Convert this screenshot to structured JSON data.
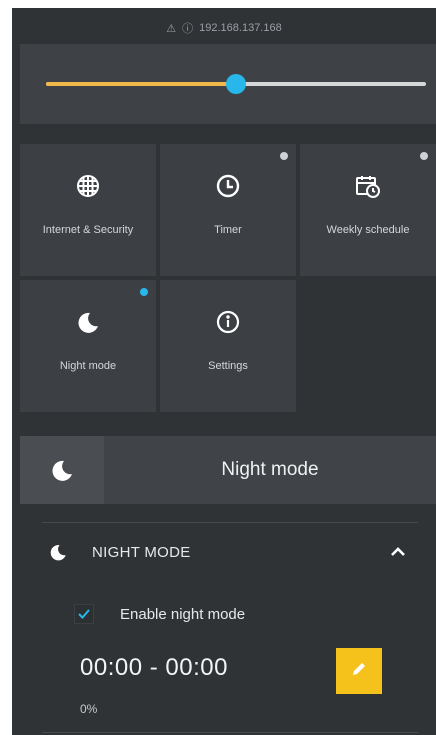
{
  "address_bar": {
    "url": "192.168.137.168",
    "warning_icon": "warning-icon",
    "info_icon": "info-circle-icon"
  },
  "brightness_slider": {
    "value_percent": 50,
    "fill_color": "#f0b94a",
    "thumb_color": "#28b7ea"
  },
  "tiles": [
    {
      "label": "Internet & Security",
      "icon": "globe-icon",
      "badge": false
    },
    {
      "label": "Timer",
      "icon": "clock-icon",
      "badge": true,
      "badge_color": "#cfd2d5"
    },
    {
      "label": "Weekly schedule",
      "icon": "weekly-schedule-icon",
      "badge": true,
      "badge_color": "#cfd2d5"
    },
    {
      "label": "Night mode",
      "icon": "moon-icon",
      "badge": true,
      "badge_color": "#28b7ea"
    },
    {
      "label": "Settings",
      "icon": "info-icon",
      "badge": false
    }
  ],
  "banner": {
    "title": "Night mode",
    "icon": "moon-icon"
  },
  "section": {
    "title": "NIGHT MODE",
    "icon": "moon-icon",
    "expanded": true,
    "enable_label": "Enable night mode",
    "enable_checked": true,
    "time_range": "00:00 - 00:00",
    "percent": "0%",
    "edit_icon": "pencil-icon",
    "accent_color": "#f4c21b"
  }
}
